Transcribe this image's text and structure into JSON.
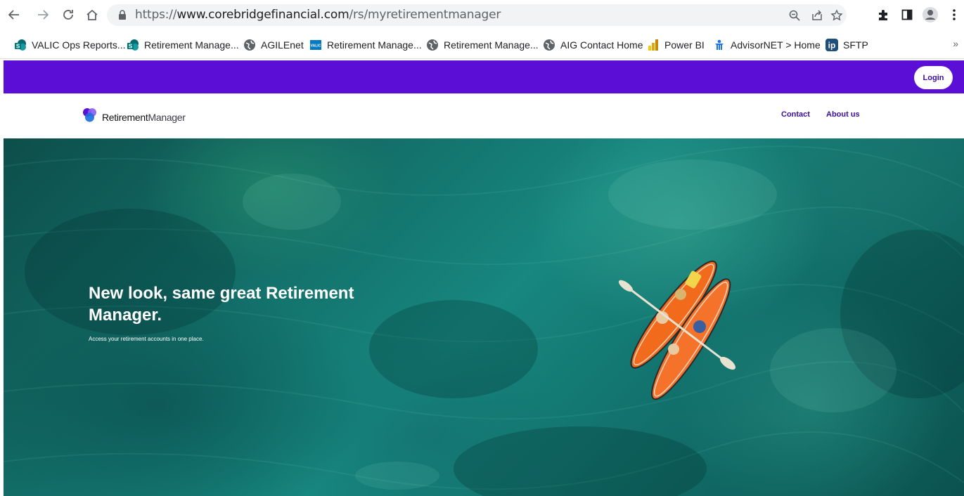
{
  "browser": {
    "url_scheme": "https://",
    "url_host": "www.corebridgefinancial.com",
    "url_path": "/rs/myretirementmanager"
  },
  "bookmarks": [
    {
      "label": "VALIC Ops Reports...",
      "icon": "sharepoint-icon"
    },
    {
      "label": "Retirement Manage...",
      "icon": "sharepoint-icon"
    },
    {
      "label": "AGILEnet",
      "icon": "globe-icon"
    },
    {
      "label": "Retirement Manage...",
      "icon": "valic-icon"
    },
    {
      "label": "Retirement Manage...",
      "icon": "globe-icon"
    },
    {
      "label": "AIG Contact Home",
      "icon": "globe-icon"
    },
    {
      "label": "Power BI",
      "icon": "powerbi-icon"
    },
    {
      "label": "AdvisorNET > Home",
      "icon": "advisornet-icon"
    },
    {
      "label": "SFTP",
      "icon": "ip-icon"
    }
  ],
  "bookmarks_more": "»",
  "site": {
    "login_label": "Login",
    "logo_bold": "Retirement",
    "logo_light": "Manager",
    "nav": {
      "contact": "Contact",
      "about": "About us"
    },
    "hero": {
      "title": "New look, same great Retirement Manager.",
      "subtitle": "Access your retirement accounts in one place."
    }
  },
  "colors": {
    "brand_purple": "#5b0fd6",
    "link_purple": "#3b0d9c",
    "hero_teal": "#13706a",
    "kayak_orange": "#f26a1b"
  },
  "valic_badge": "VALIC"
}
